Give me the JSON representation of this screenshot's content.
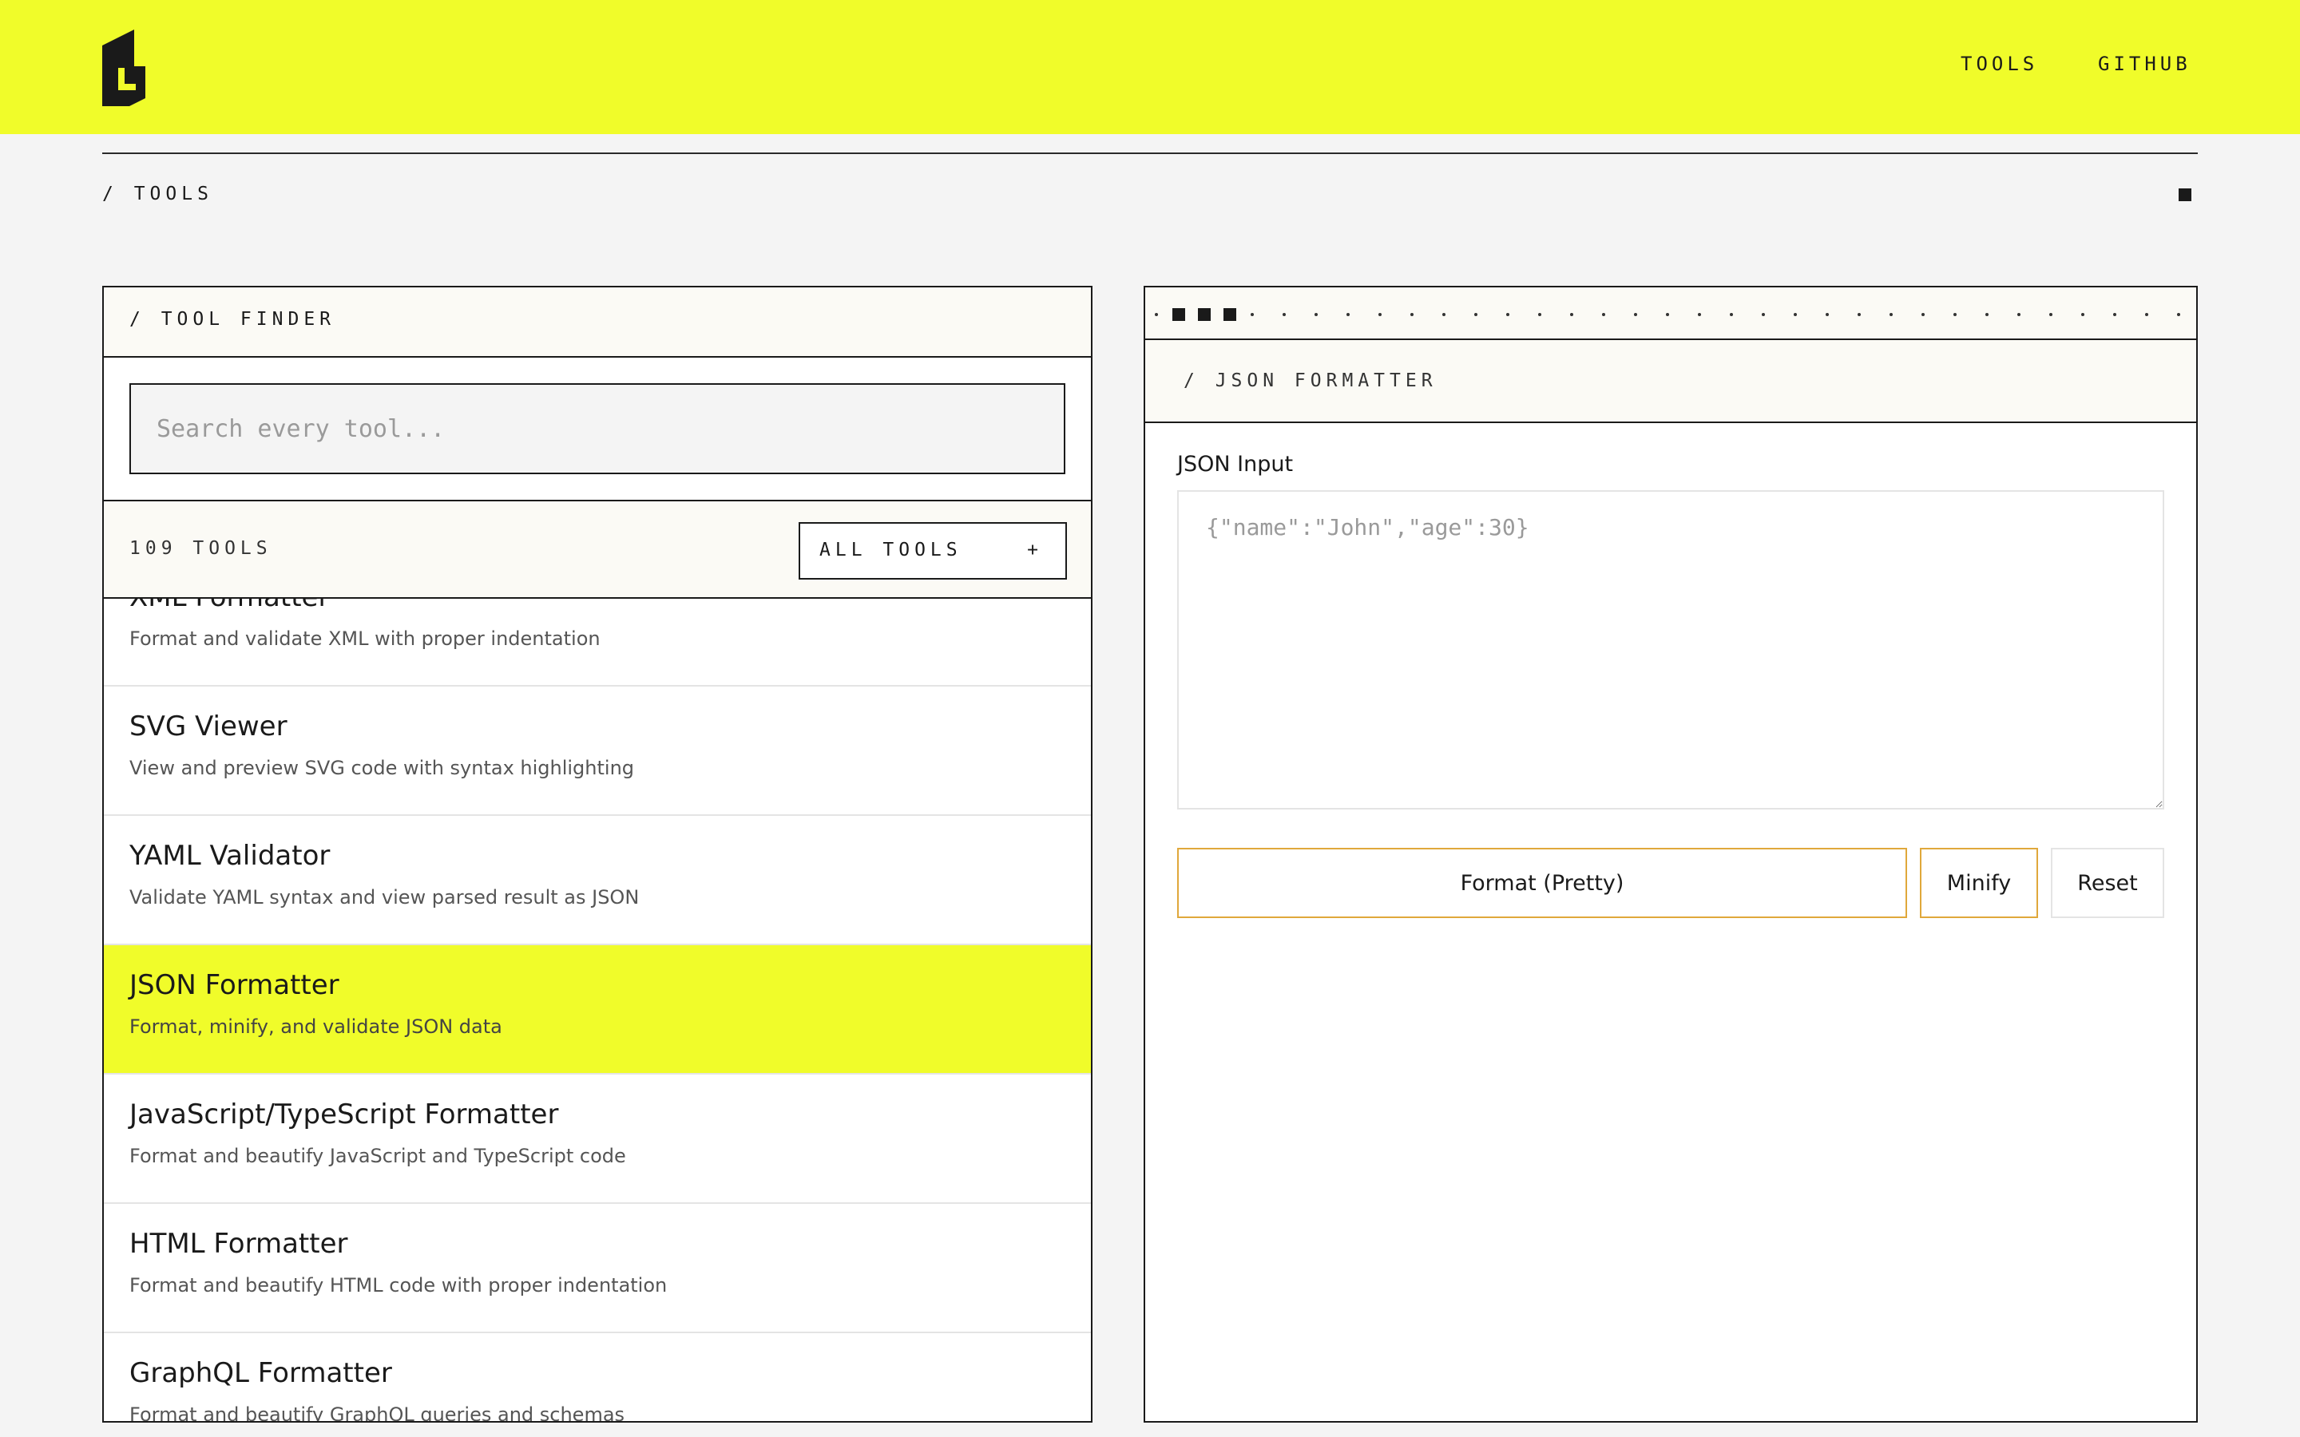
{
  "header": {
    "logo": "brand-logo",
    "nav": [
      {
        "label": "TOOLS"
      },
      {
        "label": "GITHUB"
      }
    ]
  },
  "breadcrumb": "/  TOOLS",
  "tool_finder": {
    "title": "/  TOOL FINDER",
    "search_placeholder": "Search every tool...",
    "count": "109 TOOLS",
    "filter_label": "ALL TOOLS",
    "filter_icon": "+",
    "items": [
      {
        "name": "XML Formatter",
        "desc": "Format and validate XML with proper indentation"
      },
      {
        "name": "SVG Viewer",
        "desc": "View and preview SVG code with syntax highlighting"
      },
      {
        "name": "YAML Validator",
        "desc": "Validate YAML syntax and view parsed result as JSON"
      },
      {
        "name": "JSON Formatter",
        "desc": "Format, minify, and validate JSON data",
        "active": true
      },
      {
        "name": "JavaScript/TypeScript Formatter",
        "desc": "Format and beautify JavaScript and TypeScript code"
      },
      {
        "name": "HTML Formatter",
        "desc": "Format and beautify HTML code with proper indentation"
      },
      {
        "name": "GraphQL Formatter",
        "desc": "Format and beautify GraphQL queries and schemas"
      }
    ]
  },
  "json_formatter": {
    "title": "/  JSON FORMATTER",
    "input_label": "JSON Input",
    "input_placeholder": "{\"name\":\"John\",\"age\":30}",
    "format_label": "Format (Pretty)",
    "minify_label": "Minify",
    "reset_label": "Reset"
  },
  "colors": {
    "accent": "#f0fc2a",
    "button_border": "#e0a83b",
    "ink": "#1a1a1a"
  }
}
